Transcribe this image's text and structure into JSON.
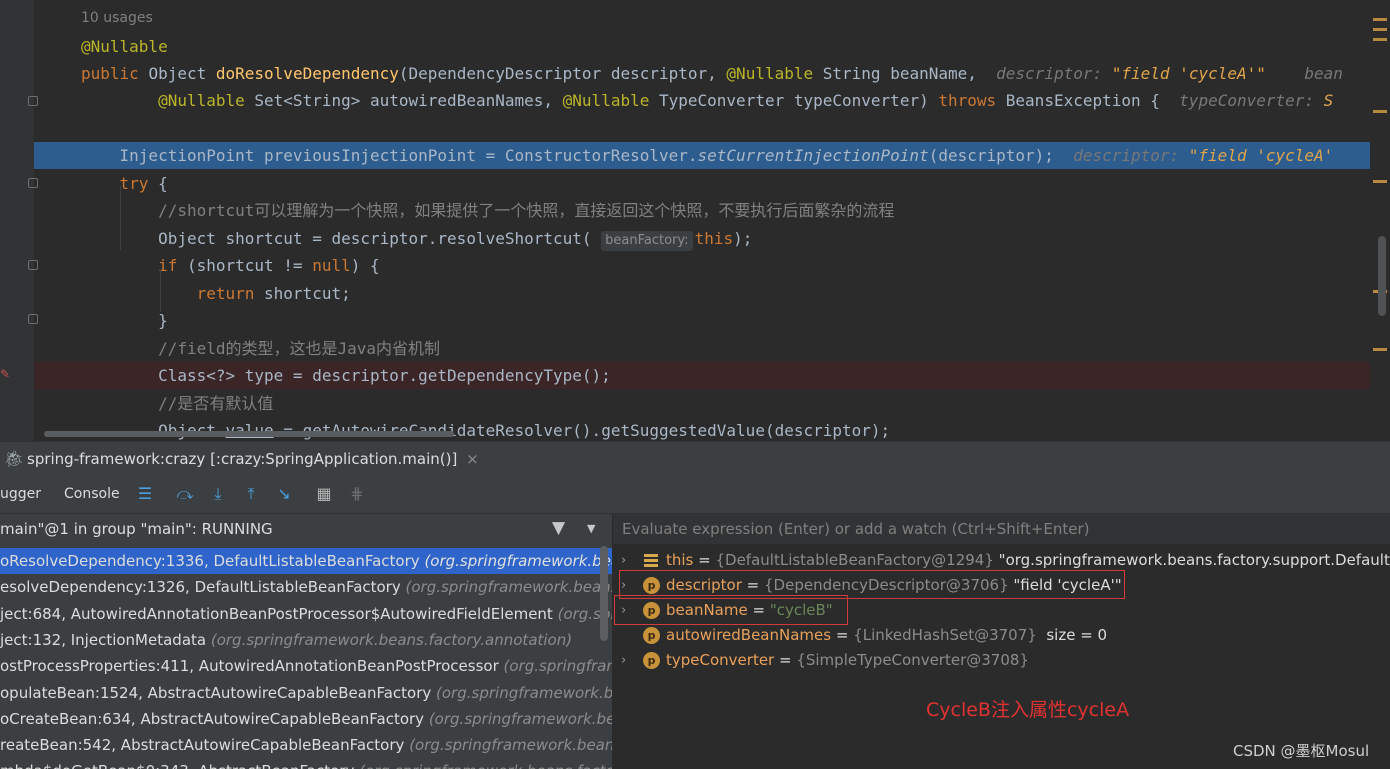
{
  "editor": {
    "usages": "10 usages",
    "lines": [
      {
        "segments": [
          {
            "t": "@Nullable",
            "c": "ann"
          }
        ]
      },
      {
        "segments": [
          {
            "t": "public ",
            "c": "kw"
          },
          {
            "t": "Object "
          },
          {
            "t": "doResolveDependency",
            "c": "fn"
          },
          {
            "t": "(DependencyDescriptor descriptor, "
          },
          {
            "t": "@Nullable",
            "c": "ann"
          },
          {
            "t": " String beanName,  "
          },
          {
            "t": "descriptor: ",
            "c": "hint-name"
          },
          {
            "t": "\"field 'cycleA'\"",
            "c": "hint-val"
          },
          {
            "t": "    bean",
            "c": "hint-name"
          }
        ]
      },
      {
        "segments": [
          {
            "t": "        "
          },
          {
            "t": "@Nullable",
            "c": "ann"
          },
          {
            "t": " Set<String> autowiredBeanNames, "
          },
          {
            "t": "@Nullable",
            "c": "ann"
          },
          {
            "t": " TypeConverter typeConverter) "
          },
          {
            "t": "throws ",
            "c": "kw"
          },
          {
            "t": "BeansException {  "
          },
          {
            "t": "typeConverter: ",
            "c": "hint-name"
          },
          {
            "t": "S",
            "c": "hint-val"
          }
        ]
      },
      {
        "segments": []
      },
      {
        "segments": [
          {
            "t": "    InjectionPoint previousInjectionPoint = ConstructorResolver."
          },
          {
            "t": "setCurrentInjectionPoint",
            "c": "ital"
          },
          {
            "t": "(descriptor);  "
          },
          {
            "t": "descriptor: ",
            "c": "hint-name"
          },
          {
            "t": "\"field 'cycleA'",
            "c": "hint-val"
          }
        ]
      },
      {
        "segments": [
          {
            "t": "    "
          },
          {
            "t": "try ",
            "c": "kw"
          },
          {
            "t": "{"
          }
        ]
      },
      {
        "segments": [
          {
            "t": "        "
          },
          {
            "t": "//shortcut可以理解为一个快照，如果提供了一个快照，直接返回这个快照，不要执行后面繁杂的流程",
            "c": "cmt"
          }
        ]
      },
      {
        "segments": [
          {
            "t": "        Object shortcut = descriptor.resolveShortcut( "
          },
          {
            "t": "beanFactory:",
            "c": "param-hint"
          },
          {
            "t": "this",
            "c": "kw"
          },
          {
            "t": ");"
          }
        ]
      },
      {
        "segments": [
          {
            "t": "        "
          },
          {
            "t": "if ",
            "c": "kw"
          },
          {
            "t": "(shortcut != "
          },
          {
            "t": "null",
            "c": "kw"
          },
          {
            "t": ") {"
          }
        ]
      },
      {
        "segments": [
          {
            "t": "            "
          },
          {
            "t": "return ",
            "c": "kw"
          },
          {
            "t": "shortcut;"
          }
        ]
      },
      {
        "segments": [
          {
            "t": "        }"
          }
        ]
      },
      {
        "segments": [
          {
            "t": "        "
          },
          {
            "t": "//field的类型，这也是Java内省机制",
            "c": "cmt"
          }
        ]
      },
      {
        "segments": [
          {
            "t": "        Class<?> type = descriptor.getDependencyType();"
          }
        ]
      },
      {
        "segments": [
          {
            "t": "        "
          },
          {
            "t": "//是否有默认值",
            "c": "cmt"
          }
        ]
      },
      {
        "segments": [
          {
            "t": "        Object "
          },
          {
            "t": "value",
            "c": "uline"
          },
          {
            "t": " = getAutowireCandidateResolver().getSuggestedValue(descriptor);"
          }
        ]
      }
    ]
  },
  "debug": {
    "session_title": "spring-framework:crazy [:crazy:SpringApplication.main()]",
    "session_close": "×",
    "tabs": {
      "debugger": "ugger",
      "console": "Console"
    },
    "thread": "main\"@1 in group \"main\": RUNNING",
    "frames": [
      {
        "method": "oResolveDependency:1336, DefaultListableBeanFactory ",
        "pkg": "(org.springframework.beans"
      },
      {
        "method": "esolveDependency:1326, DefaultListableBeanFactory ",
        "pkg": "(org.springframework.beans.fac"
      },
      {
        "method": "ject:684, AutowiredAnnotationBeanPostProcessor$AutowiredFieldElement ",
        "pkg": "(org.spri"
      },
      {
        "method": "ject:132, InjectionMetadata ",
        "pkg": "(org.springframework.beans.factory.annotation)"
      },
      {
        "method": "ostProcessProperties:411, AutowiredAnnotationBeanPostProcessor ",
        "pkg": "(org.springframe"
      },
      {
        "method": "opulateBean:1524, AbstractAutowireCapableBeanFactory ",
        "pkg": "(org.springframework.bean"
      },
      {
        "method": "oCreateBean:634, AbstractAutowireCapableBeanFactory ",
        "pkg": "(org.springframework.bean"
      },
      {
        "method": "reateBean:542, AbstractAutowireCapableBeanFactory ",
        "pkg": "(org.springframework.beans.fa"
      },
      {
        "method": "mbda$doGetBean$0:343, AbstractBeanFactory ",
        "pkg": "(org.springframework.beans.factor"
      }
    ],
    "eval_placeholder": "Evaluate expression (Enter) or add a watch (Ctrl+Shift+Enter)",
    "variables": [
      {
        "chev": "›",
        "badge": "",
        "name": "this",
        "type": "{DefaultListableBeanFactory@1294}",
        "value": " \"org.springframework.beans.factory.support.DefaultListab"
      },
      {
        "chev": "›",
        "badge": "p",
        "name": "descriptor",
        "type": "{DependencyDescriptor@3706}",
        "value": " \"field 'cycleA'\""
      },
      {
        "chev": "›",
        "badge": "p",
        "name": "beanName",
        "type": "",
        "value": "\"cycleB\""
      },
      {
        "chev": "",
        "badge": "p",
        "name": "autowiredBeanNames",
        "type": "{LinkedHashSet@3707}",
        "value": "  size = 0"
      },
      {
        "chev": "›",
        "badge": "p",
        "name": "typeConverter",
        "type": "{SimpleTypeConverter@3708}",
        "value": ""
      }
    ],
    "equals": " = "
  },
  "annotation": "CycleB注入属性cycleA",
  "watermark": "CSDN @墨枢Mosul",
  "colors": {
    "highlight": "#2d5c8f",
    "selected_frame": "#2f65ca",
    "annotation": "#e03232"
  }
}
